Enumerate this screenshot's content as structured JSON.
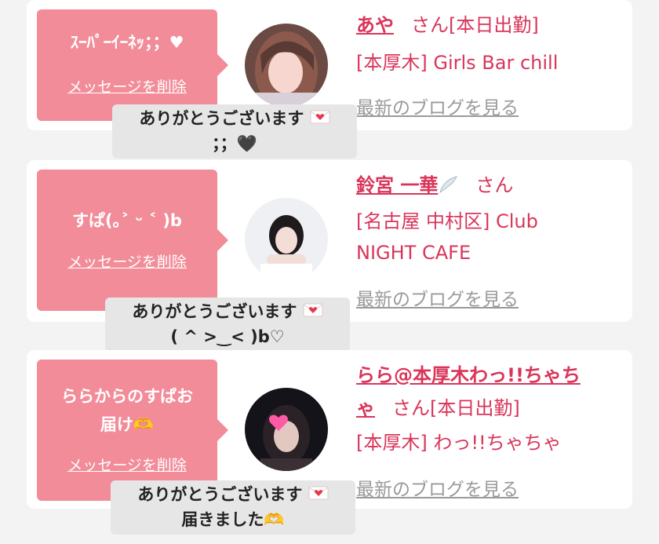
{
  "messages": [
    {
      "bubble_text": "ｽｰﾊﾟｰｲｰﾈｯ；；♥",
      "delete_label": "メッセージを削除",
      "name": "あや",
      "honorific": "さん",
      "status": "[本日出勤]",
      "shop": "[本厚木] Girls Bar chill",
      "blog_label": "最新のブログを見る",
      "reply_line1": "ありがとうございます",
      "reply_line2": "；；🖤"
    },
    {
      "bubble_text": "すぱ(｡˃ ᵕ ˂ )b",
      "delete_label": "メッセージを削除",
      "name": "鈴宮 一華",
      "honorific": "さん",
      "shop_line1": "[名古屋 中村区] Club",
      "shop_line2": "NIGHT CAFE",
      "blog_label": "最新のブログを見る",
      "reply_line1": "ありがとうございます",
      "reply_line2": "( ^ >‿< )b♡"
    },
    {
      "bubble_line1": "ららからのすぱお",
      "bubble_line2": "届け🫶",
      "delete_label": "メッセージを削除",
      "name_line1": "らら@本厚木わっ!!ちゃち",
      "name_line2": "ゃ",
      "honorific": "さん",
      "status": "[本日出勤]",
      "shop": "[本厚木] わっ!!ちゃちゃ",
      "blog_label": "最新のブログを見る",
      "reply_line1": "ありがとうございます",
      "reply_line2": "届きました🫶"
    }
  ],
  "colors": {
    "bubble": "#f28c99",
    "link": "#d9355a",
    "blog_link": "#9a9a9a",
    "reply_bg": "#e6e6e6",
    "page_bg": "#f3f3f3"
  },
  "icons": [
    "envelope-heart-icon",
    "feather-wing-icon",
    "heart-hands-icon"
  ]
}
